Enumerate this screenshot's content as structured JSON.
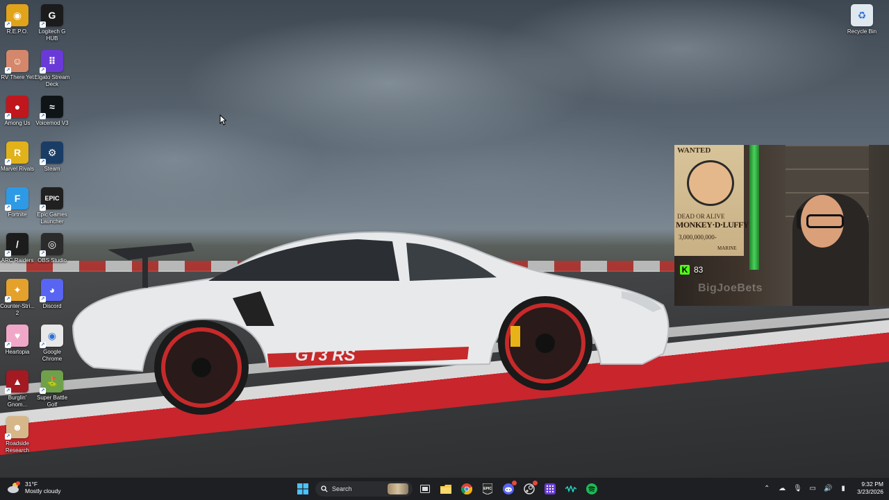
{
  "desktop": {
    "icons": [
      {
        "label": "R.E.P.O.",
        "icon": "repo-game-icon",
        "color": "#e0a31a",
        "glyph": "◉"
      },
      {
        "label": "Logitech G HUB",
        "icon": "logitech-g-hub-icon",
        "color": "#1b1b1b",
        "glyph": "G"
      },
      {
        "label": "RV There Yet",
        "icon": "rv-there-yet-icon",
        "color": "#d4876a",
        "glyph": "☺"
      },
      {
        "label": "Elgato Stream Deck",
        "icon": "elgato-stream-deck-icon",
        "color": "#6a3ad8",
        "glyph": "⠿"
      },
      {
        "label": "Among Us",
        "icon": "among-us-icon",
        "color": "#c0161d",
        "glyph": "●"
      },
      {
        "label": "Voicemod V3",
        "icon": "voicemod-icon",
        "color": "#0f1416",
        "glyph": "≈"
      },
      {
        "label": "Marvel Rivals",
        "icon": "marvel-rivals-icon",
        "color": "#e2b21b",
        "glyph": "R"
      },
      {
        "label": "Steam",
        "icon": "steam-icon",
        "color": "#1a3d66",
        "glyph": "⚙"
      },
      {
        "label": "Fortnite",
        "icon": "fortnite-icon",
        "color": "#2e9ae6",
        "glyph": "F"
      },
      {
        "label": "Epic Games Launcher",
        "icon": "epic-games-icon",
        "color": "#202020",
        "glyph": "EPIC"
      },
      {
        "label": "ARC Raiders",
        "icon": "arc-raiders-icon",
        "color": "#1c1c1c",
        "glyph": "/"
      },
      {
        "label": "OBS Studio",
        "icon": "obs-studio-icon",
        "color": "#2b2b2b",
        "glyph": "◎"
      },
      {
        "label": "Counter-Stri... 2",
        "icon": "counter-strike-icon",
        "color": "#e4a12b",
        "glyph": "✦"
      },
      {
        "label": "Discord",
        "icon": "discord-icon",
        "color": "#5865f2",
        "glyph": "◕"
      },
      {
        "label": "Heartopia",
        "icon": "heartopia-icon",
        "color": "#f1a8c8",
        "glyph": "♥"
      },
      {
        "label": "Google Chrome",
        "icon": "google-chrome-icon",
        "color": "#e8e8e8",
        "glyph": "◉"
      },
      {
        "label": "Burglin' Gnom...",
        "icon": "burglin-gnomes-icon",
        "color": "#a31a22",
        "glyph": "▲"
      },
      {
        "label": "Super Battle Golf",
        "icon": "super-battle-golf-icon",
        "color": "#6fa04a",
        "glyph": "⛳"
      },
      {
        "label": "Roadside Research",
        "icon": "roadside-research-icon",
        "color": "#d6b78a",
        "glyph": "☻"
      },
      {
        "label": "Recycle Bin",
        "icon": "recycle-bin-icon",
        "color": "#dfe8ef",
        "glyph": "♻"
      }
    ]
  },
  "webcam": {
    "poster_wanted": "WANTED",
    "poster_dead_or_alive": "DEAD OR ALIVE",
    "poster_name": "MONKEY·D·LUFFY",
    "poster_bounty": "3,000,000,000-",
    "poster_marine": "MARINE",
    "kick_logo": "K",
    "viewer_count": "83",
    "watermark": "BigJoeBets"
  },
  "taskbar": {
    "weather_temp": "31°F",
    "weather_desc": "Mostly cloudy",
    "search_placeholder": "Search",
    "time": "9:32 PM",
    "date": "3/23/2026",
    "chrome_color": "#4285f4",
    "spotify_color": "#1db954",
    "accent": "#4cc2ff"
  },
  "car": {
    "badge": "GT3 RS"
  }
}
